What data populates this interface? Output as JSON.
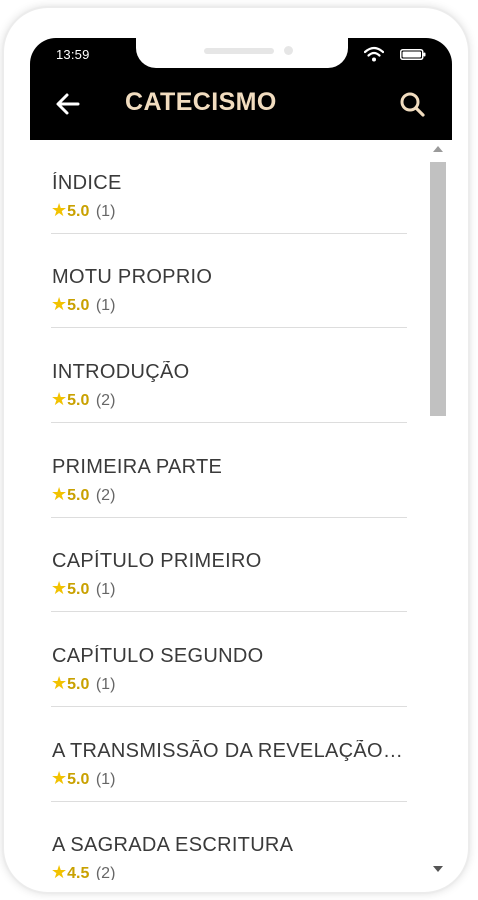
{
  "status_bar": {
    "time": "13:59",
    "icons": [
      "wifi-icon",
      "battery-icon"
    ]
  },
  "header": {
    "title": "CATECISMO",
    "back_icon": "arrow-left-icon",
    "search_icon": "search-icon",
    "background": "#000000",
    "title_color": "#f1dcbf"
  },
  "list": {
    "star_color": "#f2c200",
    "items": [
      {
        "title": "ÍNDICE",
        "rating": "5.0",
        "count": "(1)"
      },
      {
        "title": "MOTU PROPRIO",
        "rating": "5.0",
        "count": "(1)"
      },
      {
        "title": "INTRODUÇÃO",
        "rating": "5.0",
        "count": "(2)"
      },
      {
        "title": "PRIMEIRA PARTE",
        "rating": "5.0",
        "count": "(2)"
      },
      {
        "title": "CAPÍTULO PRIMEIRO",
        "rating": "5.0",
        "count": "(1)"
      },
      {
        "title": "CAPÍTULO SEGUNDO",
        "rating": "5.0",
        "count": "(1)"
      },
      {
        "title": "A TRANSMISSÃO DA REVELAÇÃO DIVINA",
        "rating": "5.0",
        "count": "(1)"
      },
      {
        "title": "A SAGRADA ESCRITURA",
        "rating": "4.5",
        "count": "(2)"
      }
    ]
  }
}
